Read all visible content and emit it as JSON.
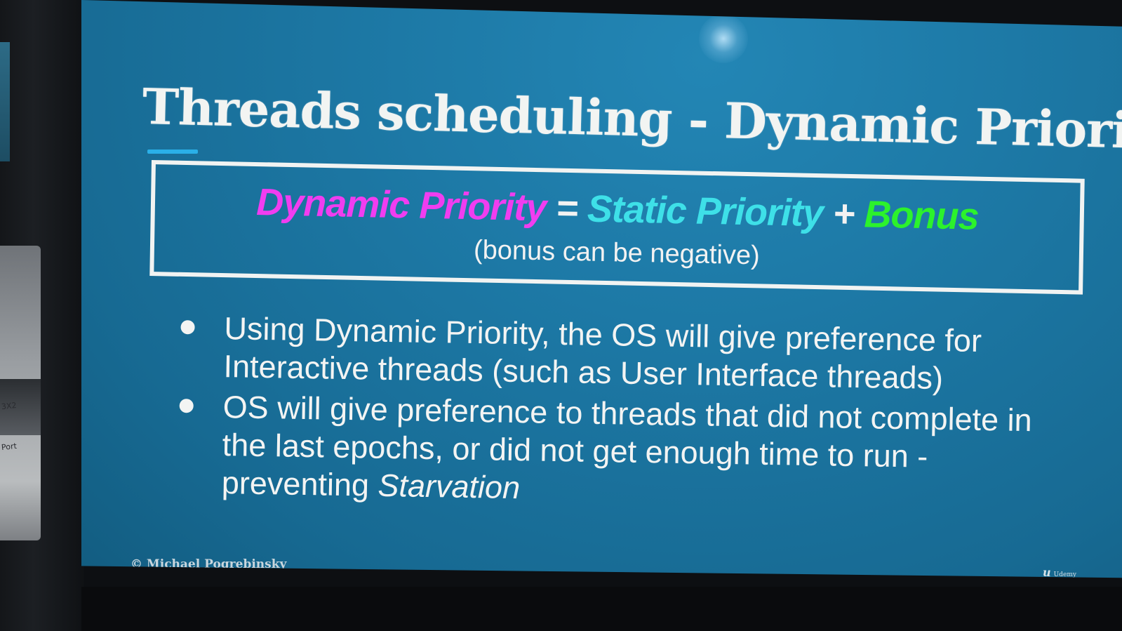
{
  "slide": {
    "title": "Threads scheduling - Dynamic Priority",
    "formula": {
      "term1": "Dynamic Priority",
      "equals": "=",
      "term2": "Static Priority",
      "plus": "+",
      "term3": "Bonus",
      "note": "(bonus can be negative)"
    },
    "bullets": [
      {
        "text": "Using Dynamic Priority, the OS will give preference for Interactive threads (such as User Interface threads)"
      },
      {
        "text": "OS will give preference to threads that did not complete in the last epochs, or did not get enough time to run - preventing ",
        "emphasis": "Starvation"
      }
    ],
    "copyright": "© Michael Pogrebinsky",
    "logo": {
      "mark": "u",
      "word": "Udemy"
    }
  },
  "background_labels": [
    "3X2",
    "Port"
  ],
  "colors": {
    "slide_background": "#1d79a6",
    "dynamic_priority": "#f03df0",
    "static_priority": "#3ee0e8",
    "bonus": "#2cf22c",
    "text": "#f3f4f3"
  }
}
